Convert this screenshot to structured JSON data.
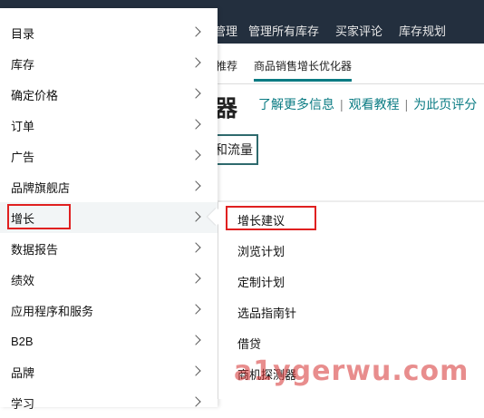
{
  "background_page": {
    "top_nav": [
      "管理",
      "管理所有库存",
      "买家评论",
      "库存规划"
    ],
    "sub_nav": {
      "left_fragment": "推荐",
      "active_tab": "商品销售增长优化器"
    },
    "title_fragment": "器",
    "help_links": [
      "了解更多信息",
      "观看教程",
      "为此页评分"
    ],
    "button_fragment": "和流量"
  },
  "menu": {
    "items": [
      {
        "label": "目录"
      },
      {
        "label": "库存"
      },
      {
        "label": "确定价格"
      },
      {
        "label": "订单"
      },
      {
        "label": "广告"
      },
      {
        "label": "品牌旗舰店"
      },
      {
        "label": "增长"
      },
      {
        "label": "数据报告"
      },
      {
        "label": "绩效"
      },
      {
        "label": "应用程序和服务"
      },
      {
        "label": "B2B"
      },
      {
        "label": "品牌"
      },
      {
        "label": "学习"
      }
    ],
    "selected": "增长"
  },
  "submenu": {
    "items": [
      {
        "label": "增长建议"
      },
      {
        "label": "浏览计划"
      },
      {
        "label": "定制计划"
      },
      {
        "label": "选品指南针"
      },
      {
        "label": "借贷"
      },
      {
        "label": "商机探测器"
      }
    ]
  },
  "watermark": "a1ygerwu.com",
  "colors": {
    "nav_dark": "#232f3e",
    "highlight_red": "#e02020",
    "link_teal": "#0a7b83"
  }
}
